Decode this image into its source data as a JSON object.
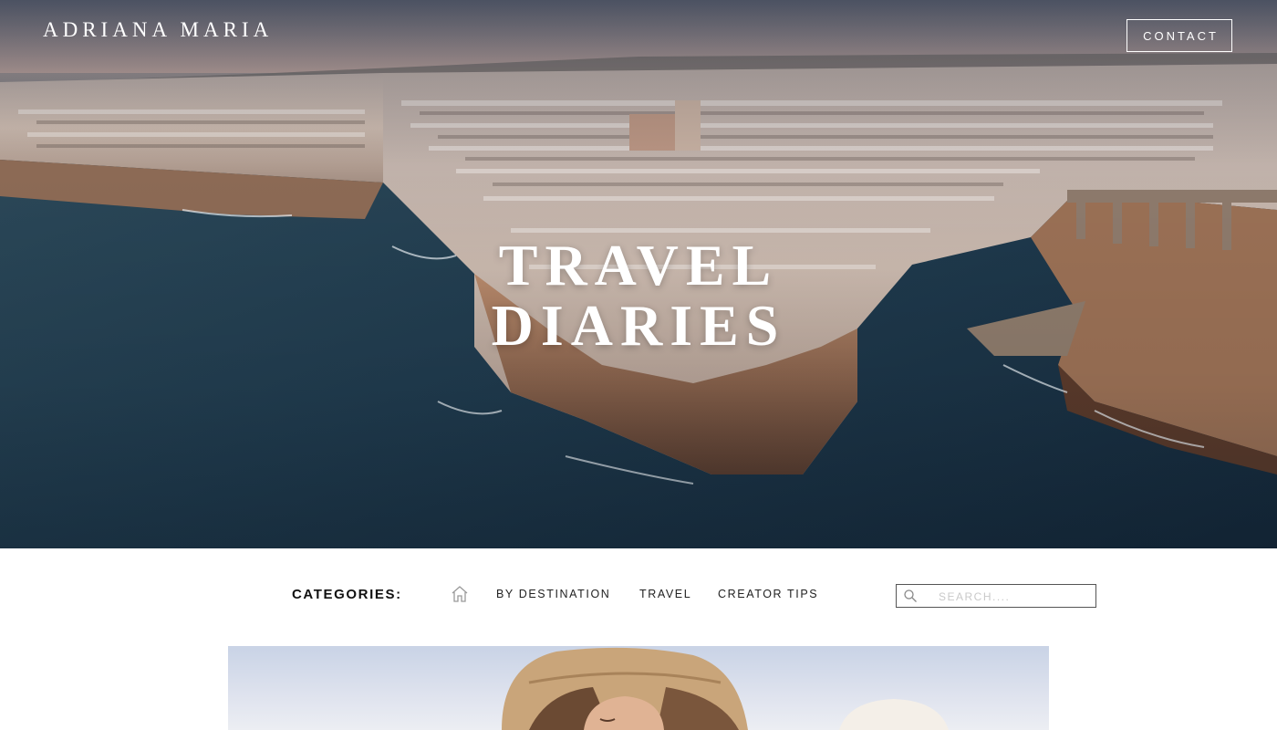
{
  "header": {
    "brand": "ADRIANA MARIA",
    "contact_label": "CONTACT"
  },
  "hero": {
    "title_line1": "TRAVEL",
    "title_line2": "DIARIES",
    "image_subject": "aerial coastal town on limestone cliffs at dusk"
  },
  "categories": {
    "label": "CATEGORIES:",
    "home_icon": "home-icon",
    "links": [
      "BY DESTINATION",
      "TRAVEL",
      "CREATOR TIPS"
    ]
  },
  "search": {
    "placeholder": "SEARCH....",
    "value": "",
    "icon": "search-icon"
  },
  "featured": {
    "image_subject": "woman in straw bucket hat against sky"
  },
  "colors": {
    "text_dark": "#111111",
    "white": "#ffffff",
    "sea": "#23384a"
  }
}
